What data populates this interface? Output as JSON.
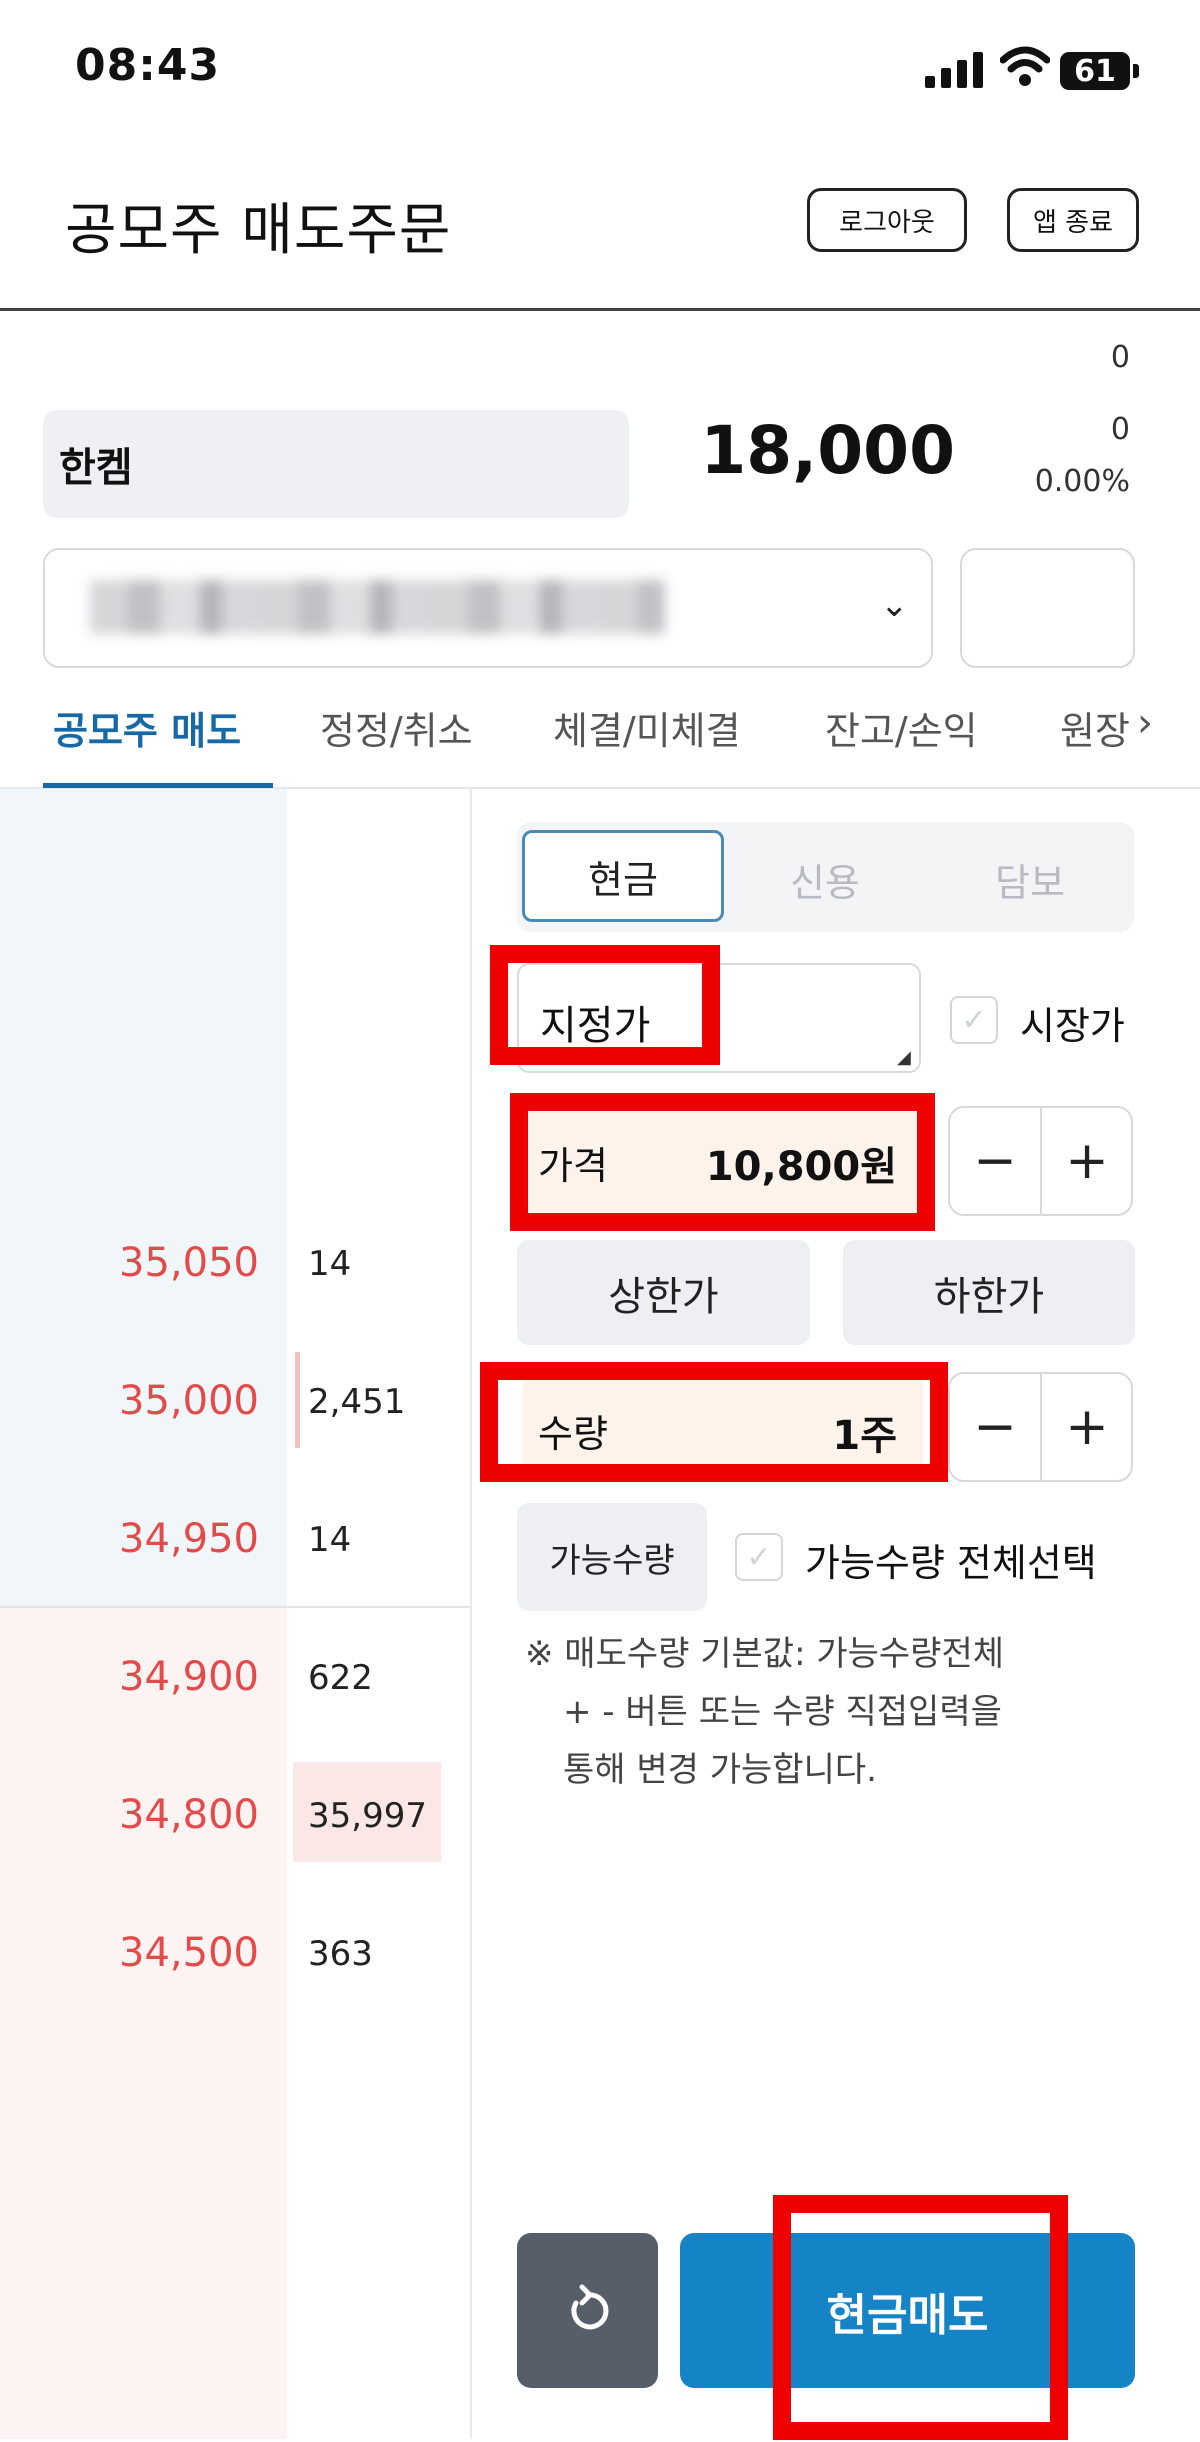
{
  "status_bar": {
    "time": "08:43",
    "battery": "61"
  },
  "header": {
    "title": "공모주 매도주문",
    "logout_label": "로그아웃",
    "exit_label": "앱 종료"
  },
  "stock": {
    "name": "한켐",
    "price": "18,000",
    "change_top": "0",
    "change": "0",
    "change_pct": "0.00%"
  },
  "tabs": [
    {
      "label": "공모주 매도",
      "active": true
    },
    {
      "label": "정정/취소"
    },
    {
      "label": "체결/미체결"
    },
    {
      "label": "잔고/손익"
    },
    {
      "label": "원장"
    }
  ],
  "orderbook": {
    "asks": [
      {
        "price": "35,050",
        "volume": "14"
      },
      {
        "price": "35,000",
        "volume": "2,451"
      },
      {
        "price": "34,950",
        "volume": "14"
      }
    ],
    "bids": [
      {
        "price": "34,900",
        "volume": "622"
      },
      {
        "price": "34,800",
        "volume": "35,997"
      },
      {
        "price": "34,500",
        "volume": "363"
      }
    ]
  },
  "order_form": {
    "segments": [
      "현금",
      "신용",
      "담보"
    ],
    "order_type": "지정가",
    "market_price_label": "시장가",
    "price_label": "가격",
    "price_value": "10,800원",
    "upper_limit_label": "상한가",
    "lower_limit_label": "하한가",
    "qty_label": "수량",
    "qty_value": "1주",
    "available_qty_label": "가능수량",
    "select_all_label": "가능수량 전체선택",
    "notice_lines": [
      "※ 매도수량 기본값: 가능수량전체",
      "+ - 버튼 또는 수량 직접입력을",
      "통해 변경 가능합니다."
    ],
    "minus": "−",
    "plus": "+",
    "submit_label": "현금매도"
  },
  "colors": {
    "accent": "#1484c7",
    "price_red": "#e34b4b",
    "tab_active": "#1768a6",
    "highlight": "#ee0000"
  }
}
